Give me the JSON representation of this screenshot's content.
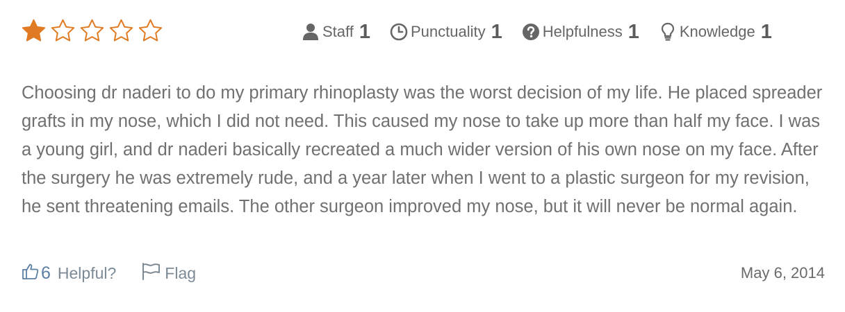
{
  "rating": {
    "stars_filled": 1,
    "stars_total": 5,
    "filled_color": "#e07b23",
    "empty_color": "#e07b23"
  },
  "categories": [
    {
      "icon": "person-icon",
      "label": "Staff",
      "value": "1"
    },
    {
      "icon": "clock-icon",
      "label": "Punctuality",
      "value": "1"
    },
    {
      "icon": "question-circle-icon",
      "label": "Helpfulness",
      "value": "1"
    },
    {
      "icon": "lightbulb-icon",
      "label": "Knowledge",
      "value": "1"
    }
  ],
  "review": {
    "text": "Choosing dr naderi to do my primary rhinoplasty was the worst decision of my life. He placed spreader grafts in my nose, which I did not need. This caused my nose to take up more than half my face. I was a young girl, and dr naderi basically recreated a much wider version of his own nose on my face. After the surgery he was extremely rude, and a year later when I went to a plastic surgeon for my revision, he sent threatening emails. The other surgeon improved my nose, but it will never be normal again."
  },
  "footer": {
    "helpful_count": "6",
    "helpful_label": "Helpful?",
    "flag_label": "Flag",
    "date": "May 6, 2014"
  },
  "colors": {
    "accent_star": "#e07b23",
    "link_blue": "#5b7fa3",
    "icon_gray": "#666666"
  }
}
